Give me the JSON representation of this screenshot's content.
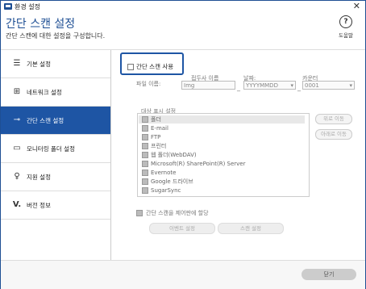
{
  "window": {
    "title": "환경 설정"
  },
  "header": {
    "title": "간단 스캔 설정",
    "subtitle": "간단 스캔에 대한 설정을 구성합니다.",
    "help_label": "도움말"
  },
  "sidebar": {
    "items": [
      {
        "label": "기본 설정",
        "icon": "list-icon"
      },
      {
        "label": "네트워크 설정",
        "icon": "network-icon"
      },
      {
        "label": "간단 스캔 설정",
        "icon": "key-icon",
        "active": true
      },
      {
        "label": "모니터링 폴더 설정",
        "icon": "folder-icon"
      },
      {
        "label": "지원 설정",
        "icon": "lightbulb-icon"
      },
      {
        "label": "버전 정보",
        "icon": "check-icon"
      }
    ]
  },
  "main": {
    "enable_label": "간단 스캔 사용",
    "filename_label": "파일 이름:",
    "prefix": {
      "title": "접두사 이름",
      "value": "Img"
    },
    "date": {
      "title": "날짜:",
      "value": "YYYYMMDD"
    },
    "counter": {
      "title": "카운터",
      "value": "0001"
    },
    "targets_label": "대상 표시 설정",
    "targets": [
      "폴더",
      "E-mail",
      "FTP",
      "프린터",
      "웹 폴더(WebDAV)",
      "Microsoft(R) SharePoint(R) Server",
      "Evernote",
      "Google 드라이브",
      "SugarSync"
    ],
    "move_up": "위로 이동",
    "move_down": "아래로 이동",
    "assign_label": "간단 스캔을 제어판에 할당",
    "event_settings": "이벤트 설정",
    "scan_settings": "스캔 설정"
  },
  "footer": {
    "close_label": "닫기"
  },
  "colors": {
    "accent": "#1e55a4",
    "title_text": "#1e4f94"
  }
}
